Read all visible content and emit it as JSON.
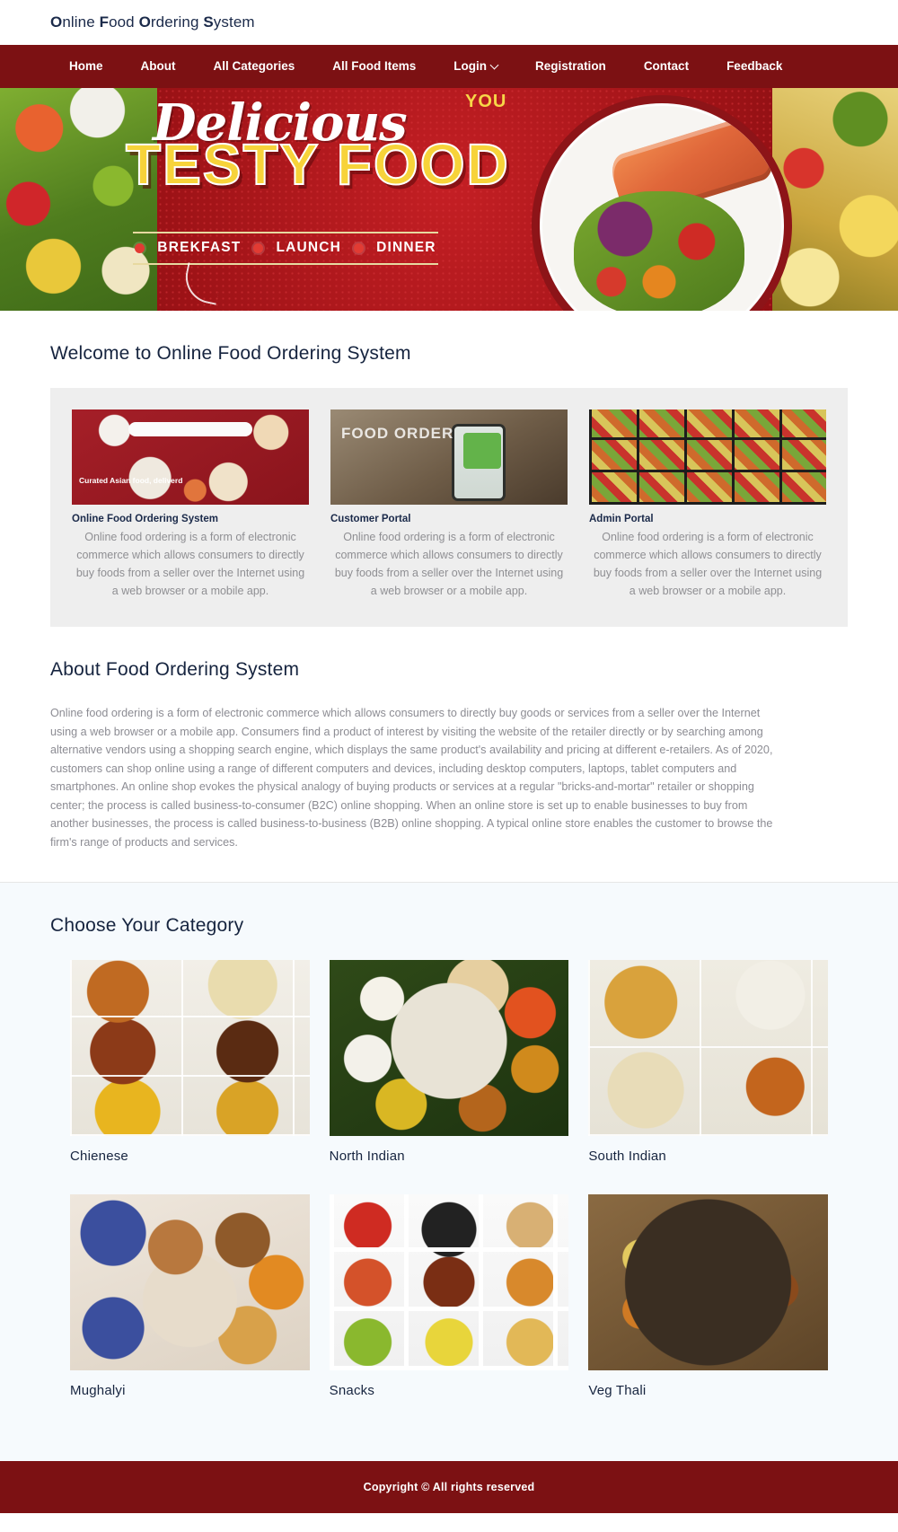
{
  "brand": {
    "full": "Online Food Ordering System",
    "parts": [
      {
        "cap": "O",
        "rest": "nline "
      },
      {
        "cap": "F",
        "rest": "ood "
      },
      {
        "cap": "O",
        "rest": "rdering "
      },
      {
        "cap": "S",
        "rest": "ystem"
      }
    ]
  },
  "nav": {
    "items": [
      {
        "label": "Home",
        "has_caret": false
      },
      {
        "label": "About",
        "has_caret": false
      },
      {
        "label": "All Categories",
        "has_caret": false
      },
      {
        "label": "All Food Items",
        "has_caret": false
      },
      {
        "label": "Login",
        "has_caret": true
      },
      {
        "label": "Registration",
        "has_caret": false
      },
      {
        "label": "Contact",
        "has_caret": false
      },
      {
        "label": "Feedback",
        "has_caret": false
      }
    ]
  },
  "hero": {
    "script_word": "Delicious",
    "you_tag": "YOU",
    "headline": "TESTY FOOD",
    "meals": [
      "BREKFAST",
      "LAUNCH",
      "DINNER"
    ]
  },
  "welcome": {
    "title": "Welcome to Online Food Ordering System",
    "cards": [
      {
        "title": "Online Food Ordering System",
        "caption": "Curated Asian food, deliverd",
        "body": "Online food ordering is a form of electronic commerce which allows consumers to directly buy foods from a seller over the Internet using a web browser or a mobile app."
      },
      {
        "title": "Customer Portal",
        "caption": "FOOD ORDER",
        "body": "Online food ordering is a form of electronic commerce which allows consumers to directly buy foods from a seller over the Internet using a web browser or a mobile app."
      },
      {
        "title": "Admin Portal",
        "caption": "",
        "body": "Online food ordering is a form of electronic commerce which allows consumers to directly buy foods from a seller over the Internet using a web browser or a mobile app."
      }
    ]
  },
  "about": {
    "title": "About Food Ordering System",
    "paragraph": "Online food ordering is a form of electronic commerce which allows consumers to directly buy goods or services from a seller over the Internet using a web browser or a mobile app. Consumers find a product of interest by visiting the website of the retailer directly or by searching among alternative vendors using a shopping search engine, which displays the same product's availability and pricing at different e-retailers. As of 2020, customers can shop online using a range of different computers and devices, including desktop computers, laptops, tablet computers and smartphones. An online shop evokes the physical analogy of buying products or services at a regular \"bricks-and-mortar\" retailer or shopping center; the process is called business-to-consumer (B2C) online shopping. When an online store is set up to enable businesses to buy from another businesses, the process is called business-to-business (B2B) online shopping. A typical online store enables the customer to browse the firm's range of products and services."
  },
  "categories": {
    "title": "Choose Your Category",
    "items": [
      {
        "label": "Chienese"
      },
      {
        "label": "North Indian"
      },
      {
        "label": "South Indian"
      },
      {
        "label": "Mughalyi"
      },
      {
        "label": "Snacks"
      },
      {
        "label": "Veg Thali"
      }
    ]
  },
  "footer": {
    "copyright": "Copyright © All rights reserved"
  },
  "colors": {
    "brand_dark_red": "#7c1113",
    "navy": "#16243f",
    "muted_text": "#8c8c93",
    "card_bg": "#eeeeee",
    "category_bg": "#f6fafd",
    "hero_yellow": "#f7d33a"
  }
}
